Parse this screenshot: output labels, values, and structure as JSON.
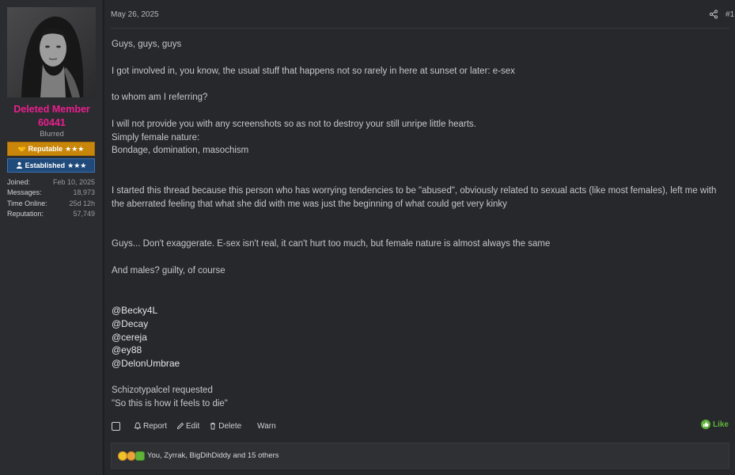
{
  "user": {
    "name": "Deleted Member 60441",
    "title": "Blurred",
    "badges": [
      {
        "label": "Reputable",
        "stars": "★★★",
        "icon": "handshake-icon"
      },
      {
        "label": "Established",
        "stars": "★★★",
        "icon": "user-icon"
      }
    ],
    "stats": [
      {
        "key": "Joined:",
        "value": "Feb 10, 2025"
      },
      {
        "key": "Messages:",
        "value": "18,973"
      },
      {
        "key": "Time Online:",
        "value": "25d 12h"
      },
      {
        "key": "Reputation:",
        "value": "57,749"
      }
    ]
  },
  "post": {
    "date": "May 26, 2025",
    "number": "#1",
    "paragraphs": [
      "Guys, guys, guys",
      "I got involved in, you know, the usual stuff that happens not so rarely in here at sunset or later: e-sex",
      "to whom am I referring?",
      "I will not provide you with any screenshots so as not to destroy your still unripe little hearts.\nSimply female nature:\nBondage, domination, masochism",
      "I started this thread because this person who has worrying tendencies to be \"abused\", obviously related to sexual acts (like most females), left me with the aberrated feeling that what she did with me was just the beginning of what could get very kinky",
      "Guys... Don't exaggerate. E-sex isn't real, it can't hurt too much, but female nature is almost always the same",
      "And males? guilty, of course"
    ],
    "mentions": [
      "@Becky4L",
      "@Decay",
      "@cereja",
      "@ey88",
      "@DelonUmbrae"
    ],
    "closing": [
      "Schizotypalcel requested",
      "\"So this is how it feels to die\""
    ]
  },
  "actions": {
    "report": "Report",
    "edit": "Edit",
    "delete": "Delete",
    "warn": "Warn",
    "like": "Like"
  },
  "reactions": {
    "text": "You, Zyrrak, BigDihDiddy and 15 others"
  },
  "colors": {
    "username": "#ea1f8f",
    "reputable_badge": "#c8860a",
    "established_badge": "#1f4a7a",
    "like": "#5fb33a"
  }
}
